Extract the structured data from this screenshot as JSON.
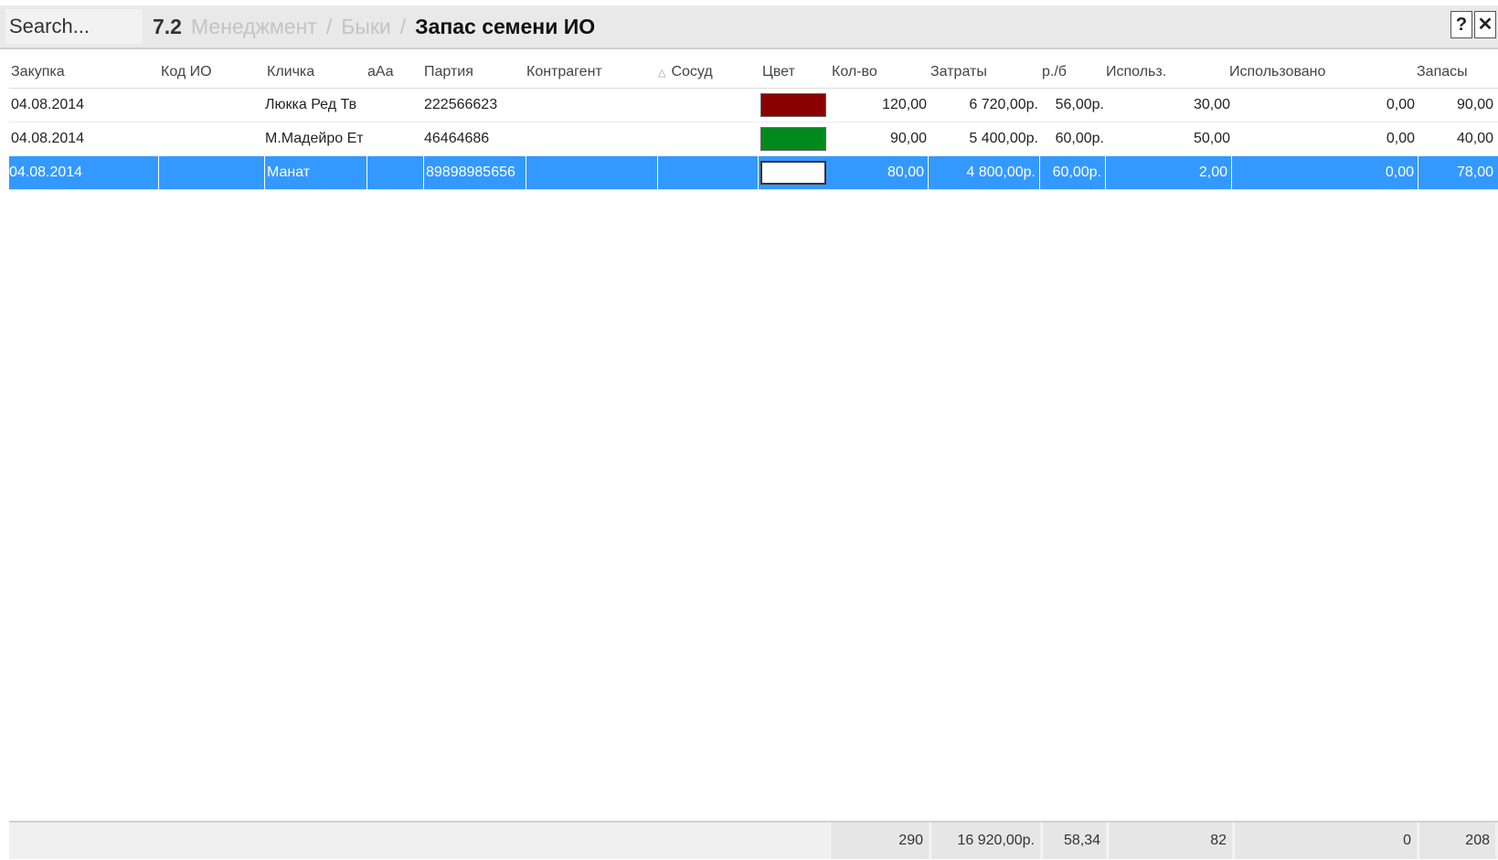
{
  "search": {
    "placeholder": "Search..."
  },
  "breadcrumb": {
    "number": "7.2",
    "items": [
      "Менеджмент",
      "Быки"
    ],
    "current": "Запас семени ИО"
  },
  "window_buttons": {
    "help": "?",
    "close": "✕"
  },
  "columns": [
    "Закупка",
    "Код ИО",
    "Кличка",
    "aAa",
    "Партия",
    "Контрагент",
    "Сосуд",
    "Цвет",
    "Кол-во",
    "Затраты",
    "р./б",
    "Использ.",
    "Использовано",
    "Запасы"
  ],
  "sort_indicator": "△",
  "rows": [
    {
      "date": "04.08.2014",
      "code": "",
      "name": "Люкка Ред Тв",
      "aaa": "",
      "batch": "222566623",
      "contractor": "",
      "vessel": "",
      "color": "#8b0000",
      "qty": "120,00",
      "cost": "6 720,00р.",
      "per": "56,00р.",
      "used_short": "30,00",
      "used": "0,00",
      "stock": "90,00"
    },
    {
      "date": "04.08.2014",
      "code": "",
      "name": "М.Мадейро Ет",
      "aaa": "",
      "batch": "46464686",
      "contractor": "",
      "vessel": "",
      "color": "#008a1e",
      "qty": "90,00",
      "cost": "5 400,00р.",
      "per": "60,00р.",
      "used_short": "50,00",
      "used": "0,00",
      "stock": "40,00"
    },
    {
      "date": "04.08.2014",
      "code": "",
      "name": "Манат",
      "aaa": "",
      "batch": "89898985656",
      "contractor": "",
      "vessel": "",
      "color": "#ffffff",
      "qty": "80,00",
      "cost": "4 800,00р.",
      "per": "60,00р.",
      "used_short": "2,00",
      "used": "0,00",
      "stock": "78,00"
    }
  ],
  "totals": {
    "qty": "290",
    "cost": "16 920,00р.",
    "per": "58,34",
    "used_short": "82",
    "used": "0",
    "stock": "208"
  }
}
